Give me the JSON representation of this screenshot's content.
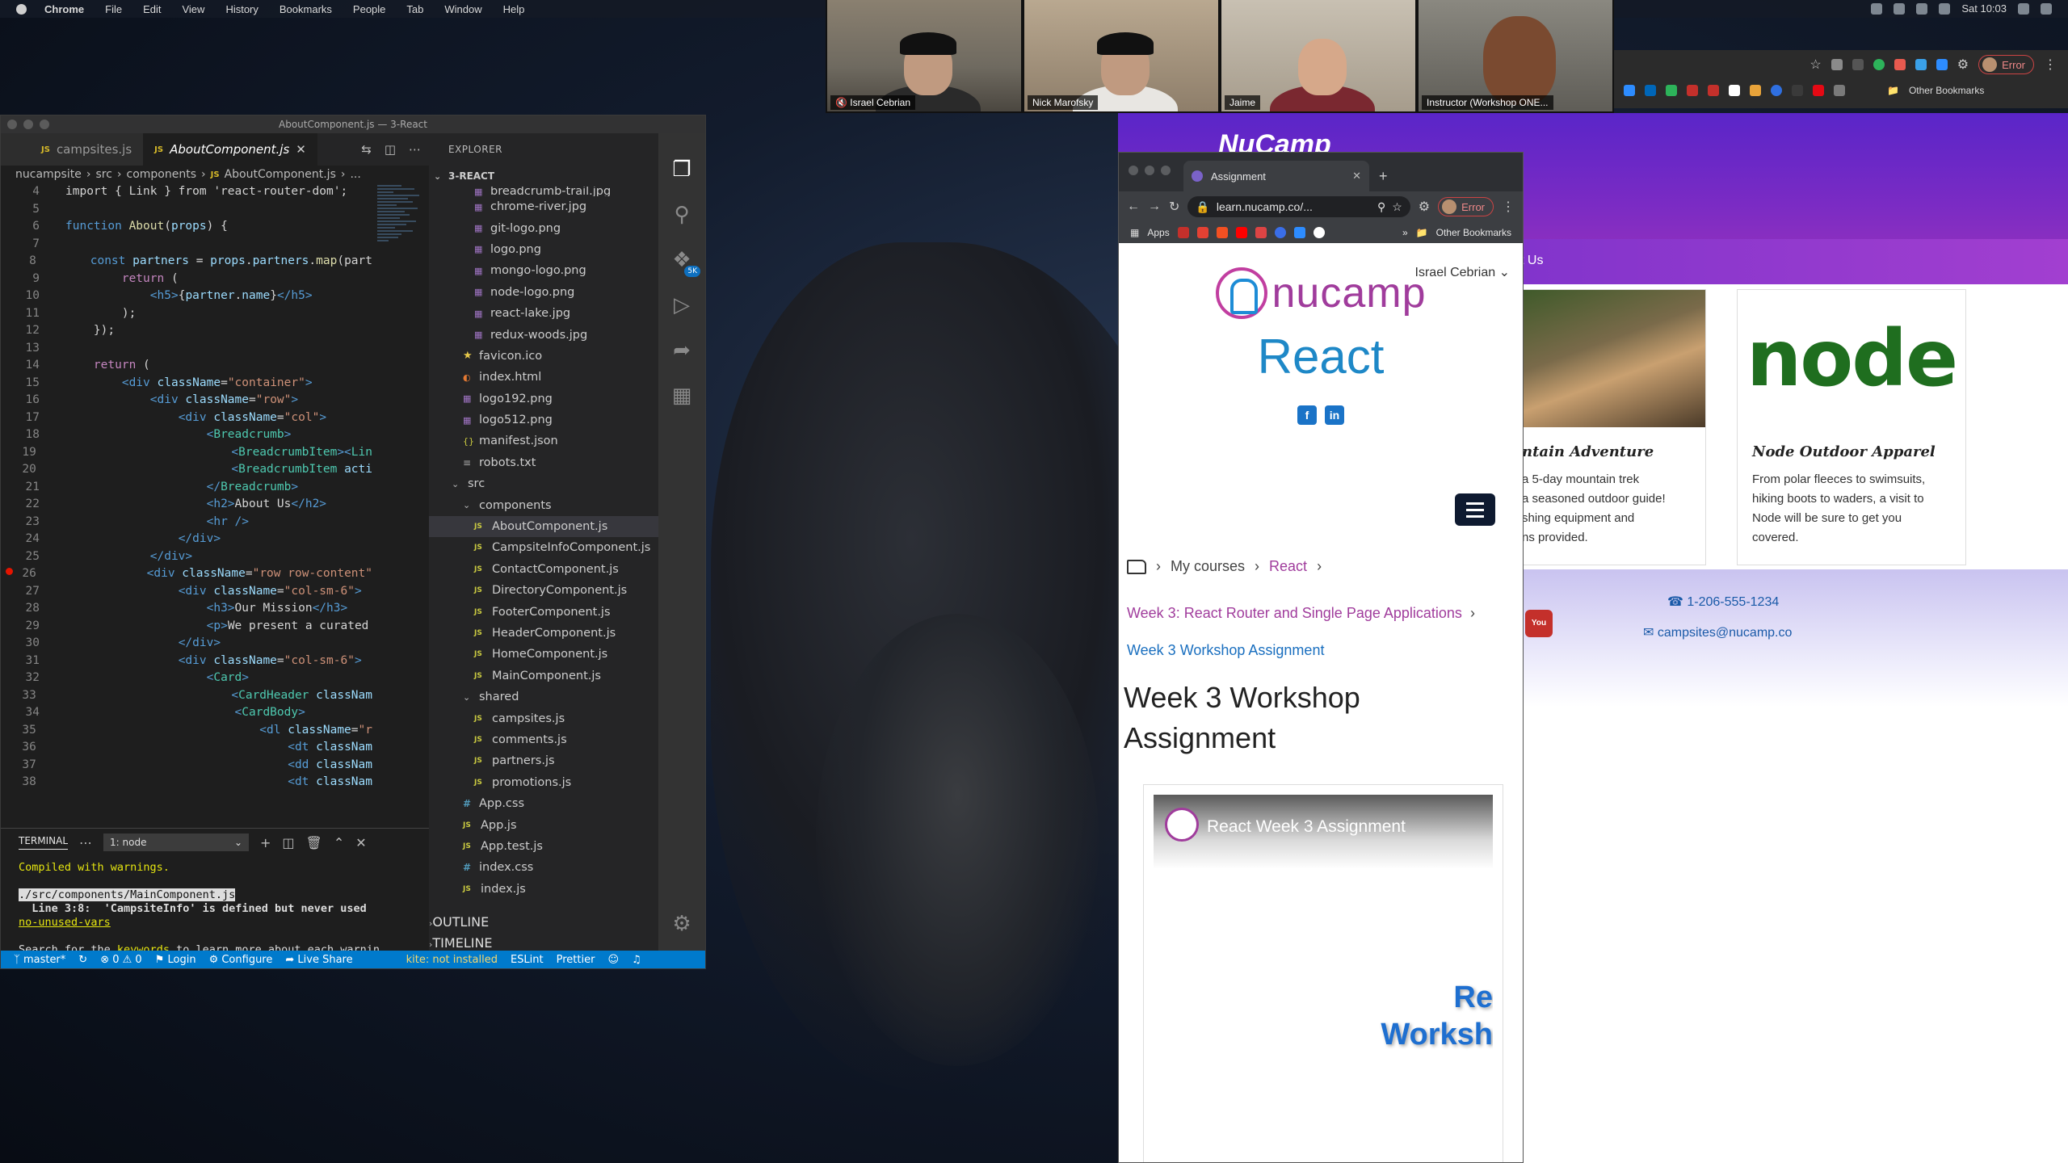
{
  "menubar": {
    "app": "Chrome",
    "items": [
      "File",
      "Edit",
      "View",
      "History",
      "Bookmarks",
      "People",
      "Tab",
      "Window",
      "Help"
    ],
    "clock": "Sat 10:03"
  },
  "zoom": {
    "participants": [
      {
        "name": "Israel Cebrian",
        "muted": true
      },
      {
        "name": "Nick Marofsky",
        "muted": false
      },
      {
        "name": "Jaime",
        "muted": false
      },
      {
        "name": "Instructor (Workshop ONE...",
        "muted": false
      }
    ]
  },
  "bg_chrome": {
    "error_label": "Error",
    "other_bookmarks": "Other Bookmarks"
  },
  "site": {
    "brand": "NuCamp",
    "nav_partial": "ct Us",
    "cards": [
      {
        "title": "ntain Adventure",
        "text": "a 5-day mountain trek\n a seasoned outdoor guide!\nshing equipment and\nns provided."
      },
      {
        "title": "Node Outdoor Apparel",
        "text": "From polar fleeces to swimsuits, hiking boots to waders, a visit to Node will be sure to get you covered."
      }
    ],
    "node_logo": "node",
    "phone": "1-206-555-1234",
    "email": "campsites@nucamp.co"
  },
  "mini_browser": {
    "tab_title": "Assignment",
    "url": "learn.nucamp.co/...",
    "error_label": "Error",
    "apps_label": "Apps",
    "other_bookmarks": "Other Bookmarks",
    "user_name": "Israel Cebrian",
    "logo_text": "nucamp",
    "course_title": "React",
    "breadcrumb": [
      "My courses",
      "React"
    ],
    "week_link": "Week 3: React Router and Single Page Applications",
    "assignment_link": "Week 3 Workshop Assignment",
    "page_title": "Week 3 Workshop Assignment",
    "video_title": "React Week 3 Assignment",
    "video_text_1": "Re",
    "video_text_2": "Worksh"
  },
  "vscode": {
    "window_title": "AboutComponent.js — 3-React",
    "tabs": [
      {
        "label": "campsites.js",
        "active": false
      },
      {
        "label": "AboutComponent.js",
        "active": true
      }
    ],
    "breadcrumb": [
      "nucampsite",
      "src",
      "components",
      "AboutComponent.js",
      "..."
    ],
    "explorer_title": "EXPLORER",
    "project": "3-REACT",
    "files": [
      {
        "label": "breadcrumb-trail.jpg",
        "type": "img",
        "indent": 2
      },
      {
        "label": "chrome-river.jpg",
        "type": "img",
        "indent": 2
      },
      {
        "label": "git-logo.png",
        "type": "img",
        "indent": 2
      },
      {
        "label": "logo.png",
        "type": "img",
        "indent": 2
      },
      {
        "label": "mongo-logo.png",
        "type": "img",
        "indent": 2
      },
      {
        "label": "node-logo.png",
        "type": "img",
        "indent": 2
      },
      {
        "label": "react-lake.jpg",
        "type": "img",
        "indent": 2
      },
      {
        "label": "redux-woods.jpg",
        "type": "img",
        "indent": 2
      },
      {
        "label": "favicon.ico",
        "type": "star",
        "indent": 1
      },
      {
        "label": "index.html",
        "type": "html",
        "indent": 1
      },
      {
        "label": "logo192.png",
        "type": "img",
        "indent": 1
      },
      {
        "label": "logo512.png",
        "type": "img",
        "indent": 1
      },
      {
        "label": "manifest.json",
        "type": "json",
        "indent": 1
      },
      {
        "label": "robots.txt",
        "type": "txt",
        "indent": 1
      },
      {
        "label": "src",
        "type": "folder",
        "indent": 0
      },
      {
        "label": "components",
        "type": "folder",
        "indent": 1
      },
      {
        "label": "AboutComponent.js",
        "type": "js",
        "indent": 2,
        "selected": true
      },
      {
        "label": "CampsiteInfoComponent.js",
        "type": "js",
        "indent": 2
      },
      {
        "label": "ContactComponent.js",
        "type": "js",
        "indent": 2
      },
      {
        "label": "DirectoryComponent.js",
        "type": "js",
        "indent": 2
      },
      {
        "label": "FooterComponent.js",
        "type": "js",
        "indent": 2
      },
      {
        "label": "HeaderComponent.js",
        "type": "js",
        "indent": 2
      },
      {
        "label": "HomeComponent.js",
        "type": "js",
        "indent": 2
      },
      {
        "label": "MainComponent.js",
        "type": "js",
        "indent": 2
      },
      {
        "label": "shared",
        "type": "folder",
        "indent": 1
      },
      {
        "label": "campsites.js",
        "type": "js",
        "indent": 2
      },
      {
        "label": "comments.js",
        "type": "js",
        "indent": 2
      },
      {
        "label": "partners.js",
        "type": "js",
        "indent": 2
      },
      {
        "label": "promotions.js",
        "type": "js",
        "indent": 2
      },
      {
        "label": "App.css",
        "type": "css",
        "indent": 1
      },
      {
        "label": "App.js",
        "type": "js",
        "indent": 1
      },
      {
        "label": "App.test.js",
        "type": "js",
        "indent": 1
      },
      {
        "label": "index.css",
        "type": "css",
        "indent": 1
      },
      {
        "label": "index.js",
        "type": "js",
        "indent": 1
      }
    ],
    "outline": "OUTLINE",
    "timeline": "TIMELINE",
    "code_lines": [
      {
        "n": "4",
        "html": "import { Link } from 'react-router-dom';"
      },
      {
        "n": "5",
        "html": ""
      },
      {
        "n": "6",
        "html": "<span class=\"kw\">function</span> <span class=\"fn\">About</span>(<span class=\"at\">props</span>) {"
      },
      {
        "n": "7",
        "html": ""
      },
      {
        "n": "8",
        "html": "    <span class=\"kw\">const</span> <span class=\"at\">partners</span> = <span class=\"at\">props</span>.<span class=\"at\">partners</span>.<span class=\"fn\">map</span>(part"
      },
      {
        "n": "9",
        "html": "        <span class=\"ctl\">return</span> ("
      },
      {
        "n": "10",
        "html": "            <span class=\"kw\">&lt;</span><span class=\"kw\">h5</span><span class=\"kw\">&gt;</span>{<span class=\"at\">partner</span>.<span class=\"at\">name</span>}<span class=\"kw\">&lt;/h5&gt;</span>"
      },
      {
        "n": "11",
        "html": "        );"
      },
      {
        "n": "12",
        "html": "    });"
      },
      {
        "n": "13",
        "html": ""
      },
      {
        "n": "14",
        "html": "    <span class=\"ctl\">return</span> ("
      },
      {
        "n": "15",
        "html": "        <span class=\"kw\">&lt;div</span> <span class=\"at\">className</span>=<span class=\"str\">\"container\"</span><span class=\"kw\">&gt;</span>"
      },
      {
        "n": "16",
        "html": "            <span class=\"kw\">&lt;div</span> <span class=\"at\">className</span>=<span class=\"str\">\"row\"</span><span class=\"kw\">&gt;</span>"
      },
      {
        "n": "17",
        "html": "                <span class=\"kw\">&lt;div</span> <span class=\"at\">className</span>=<span class=\"str\">\"col\"</span><span class=\"kw\">&gt;</span>"
      },
      {
        "n": "18",
        "html": "                    <span class=\"kw\">&lt;</span><span class=\"tag\">Breadcrumb</span><span class=\"kw\">&gt;</span>"
      },
      {
        "n": "19",
        "html": "                        <span class=\"kw\">&lt;</span><span class=\"tag\">BreadcrumbItem</span><span class=\"kw\">&gt;&lt;</span><span class=\"tag\">Lin</span>"
      },
      {
        "n": "20",
        "html": "                        <span class=\"kw\">&lt;</span><span class=\"tag\">BreadcrumbItem</span> <span class=\"at\">acti</span>"
      },
      {
        "n": "21",
        "html": "                    <span class=\"kw\">&lt;/</span><span class=\"tag\">Breadcrumb</span><span class=\"kw\">&gt;</span>"
      },
      {
        "n": "22",
        "html": "                    <span class=\"kw\">&lt;h2&gt;</span>About Us<span class=\"kw\">&lt;/h2&gt;</span>"
      },
      {
        "n": "23",
        "html": "                    <span class=\"kw\">&lt;hr /&gt;</span>"
      },
      {
        "n": "24",
        "html": "                <span class=\"kw\">&lt;/div&gt;</span>"
      },
      {
        "n": "25",
        "html": "            <span class=\"kw\">&lt;/div&gt;</span>"
      },
      {
        "n": "26",
        "html": "            <span class=\"kw\">&lt;div</span> <span class=\"at\">className</span>=<span class=\"str\">\"row row-content\"</span>"
      },
      {
        "n": "27",
        "html": "                <span class=\"kw\">&lt;div</span> <span class=\"at\">className</span>=<span class=\"str\">\"col-sm-6\"</span><span class=\"kw\">&gt;</span>"
      },
      {
        "n": "28",
        "html": "                    <span class=\"kw\">&lt;h3&gt;</span>Our Mission<span class=\"kw\">&lt;/h3&gt;</span>"
      },
      {
        "n": "29",
        "html": "                    <span class=\"kw\">&lt;p&gt;</span>We present a curated"
      },
      {
        "n": "30",
        "html": "                <span class=\"kw\">&lt;/div&gt;</span>"
      },
      {
        "n": "31",
        "html": "                <span class=\"kw\">&lt;div</span> <span class=\"at\">className</span>=<span class=\"str\">\"col-sm-6\"</span><span class=\"kw\">&gt;</span>"
      },
      {
        "n": "32",
        "html": "                    <span class=\"kw\">&lt;</span><span class=\"tag\">Card</span><span class=\"kw\">&gt;</span>"
      },
      {
        "n": "33",
        "html": "                        <span class=\"kw\">&lt;</span><span class=\"tag\">CardHeader</span> <span class=\"at\">classNam</span>"
      },
      {
        "n": "34",
        "html": "                        <span class=\"kw\">&lt;</span><span class=\"tag\">CardBody</span><span class=\"kw\">&gt;</span>"
      },
      {
        "n": "35",
        "html": "                            <span class=\"kw\">&lt;dl</span> <span class=\"at\">className</span>=<span class=\"str\">\"r</span>"
      },
      {
        "n": "36",
        "html": "                                <span class=\"kw\">&lt;dt</span> <span class=\"at\">classNam</span>"
      },
      {
        "n": "37",
        "html": "                                <span class=\"kw\">&lt;dd</span> <span class=\"at\">classNam</span>"
      },
      {
        "n": "38",
        "html": "                                <span class=\"kw\">&lt;dt</span> <span class=\"at\">classNam</span>"
      }
    ],
    "terminal": {
      "label": "TERMINAL",
      "shell": "1: node",
      "line1": "Compiled with warnings.",
      "line2": "./src/components/MainComponent.js",
      "line3": "  Line 3:8:  'CampsiteInfo' is defined but never used",
      "line3b": "no-unused-vars",
      "line4a": "Search for the ",
      "line4b": "keywords",
      "line4c": " to learn more about each warnin"
    },
    "status": {
      "branch": "master*",
      "problems": "0 ⚠ 0",
      "login": "Login",
      "configure": "Configure",
      "liveshare": "Live Share",
      "kite": "kite: not installed",
      "eslint": "ESLint",
      "prettier": "Prettier"
    }
  }
}
